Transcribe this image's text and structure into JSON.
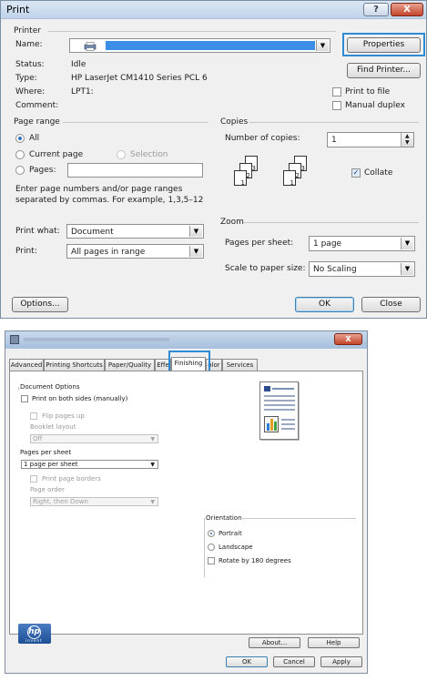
{
  "print": {
    "title": "Print",
    "help_glyph": "?",
    "close_glyph": "X",
    "printer_group": "Printer",
    "name_label": "Name:",
    "status_label": "Status:",
    "status_value": "Idle",
    "type_label": "Type:",
    "type_value": "HP LaserJet CM1410 Series PCL 6",
    "where_label": "Where:",
    "where_value": "LPT1:",
    "comment_label": "Comment:",
    "properties_button": "Properties",
    "find_printer_button": "Find Printer...",
    "print_to_file": "Print to file",
    "manual_duplex": "Manual duplex",
    "page_range_group": "Page range",
    "all_option": "All",
    "current_page_option": "Current page",
    "selection_option": "Selection",
    "pages_option": "Pages:",
    "pages_hint": "Enter page numbers and/or page ranges separated by commas.  For example, 1,3,5–12",
    "copies_group": "Copies",
    "number_of_copies_label": "Number of copies:",
    "copies_value": "1",
    "collate": "Collate",
    "print_what_label": "Print what:",
    "print_what_value": "Document",
    "print_label": "Print:",
    "print_value": "All pages in range",
    "zoom_group": "Zoom",
    "pages_per_sheet_label": "Pages per sheet:",
    "pages_per_sheet_value": "1 page",
    "scale_label": "Scale to paper size:",
    "scale_value": "No Scaling",
    "options_button": "Options...",
    "ok_button": "OK",
    "close_button": "Close",
    "collate_page_numbers": [
      "3",
      "2",
      "1",
      "3",
      "2",
      "1"
    ]
  },
  "props": {
    "close_glyph": "X",
    "tabs": [
      "Advanced",
      "Printing Shortcuts",
      "Paper/Quality",
      "Effe",
      "Finishing",
      "olor",
      "Services"
    ],
    "active_tab": "Finishing",
    "document_options": "Document Options",
    "print_both_sides": "Print on both sides (manually)",
    "flip_pages_up": "Flip pages up",
    "booklet_layout": "Booklet layout",
    "booklet_value": "Off",
    "pages_per_sheet": "Pages per sheet",
    "pages_per_sheet_value": "1 page per sheet",
    "print_page_borders": "Print page borders",
    "page_order": "Page order",
    "page_order_value": "Right, then Down",
    "orientation": "Orientation",
    "portrait": "Portrait",
    "landscape": "Landscape",
    "rotate_180": "Rotate by 180 degrees",
    "about_button": "About...",
    "help_button": "Help",
    "ok_button": "OK",
    "cancel_button": "Cancel",
    "apply_button": "Apply",
    "logo_text": "hp",
    "logo_sub": "invent"
  },
  "colors": {
    "highlight": "#2f8ad6",
    "selected_printer": "#3a8ee6",
    "titlebar": "#c1d4ea"
  }
}
